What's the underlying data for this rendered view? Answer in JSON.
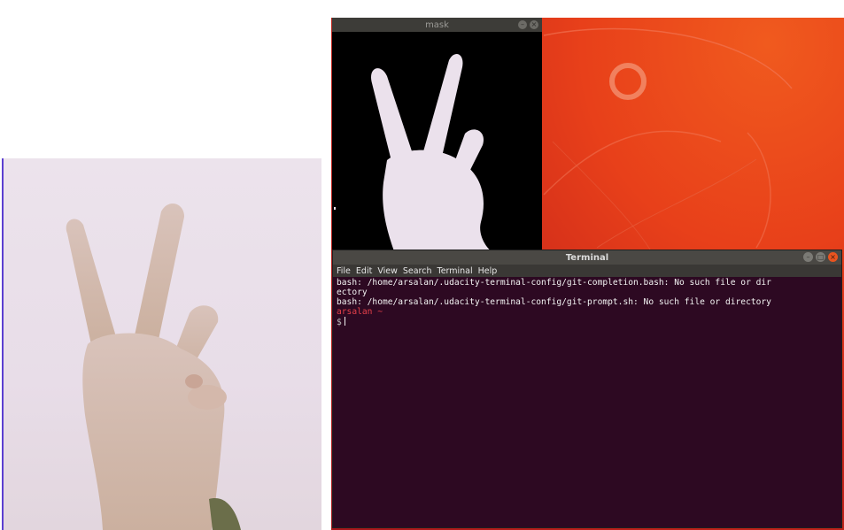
{
  "mask_window": {
    "title": "mask",
    "controls": [
      "–",
      "×"
    ]
  },
  "terminal": {
    "title": "Terminal",
    "controls": [
      "–",
      "□",
      "×"
    ],
    "menu": [
      "File",
      "Edit",
      "View",
      "Search",
      "Terminal",
      "Help"
    ],
    "lines": [
      "bash: /home/arsalan/.udacity-terminal-config/git-completion.bash: No such file or dir",
      "ectory",
      "bash: /home/arsalan/.udacity-terminal-config/git-prompt.sh: No such file or directory"
    ],
    "prompt_user": "arsalan ~",
    "prompt_symbol": "$"
  },
  "colors": {
    "terminal_bg": "#2d0922",
    "wallpaper_orange": "#e8401a",
    "prompt_red": "#e5404a"
  }
}
